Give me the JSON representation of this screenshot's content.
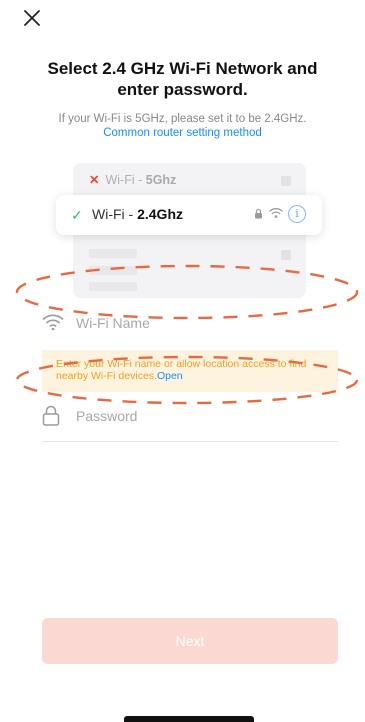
{
  "header": {
    "close_icon": "close-icon",
    "title": "Select 2.4 GHz Wi-Fi Network and enter password.",
    "subtitle": "If your Wi-Fi is 5GHz, please set it to be 2.4GHz.",
    "router_link": "Common router setting method"
  },
  "illustration": {
    "row_5g_prefix": "Wi-Fi - ",
    "row_5g_band": "5Ghz",
    "row_24_prefix": "Wi-Fi - ",
    "row_24_band": "2.4Ghz",
    "info_glyph": "i"
  },
  "form": {
    "wifi_name_placeholder": "Wi-Fi Name",
    "warning_text": "Enter your Wi-Fi name or allow location access to find nearby Wi-Fi devices.",
    "warning_link": "Open",
    "password_placeholder": "Password"
  },
  "footer": {
    "next_label": "Next"
  },
  "colors": {
    "accent_red": "#e24a3b",
    "link_blue": "#1a8cff",
    "warning_text": "#f0a020",
    "warning_bg": "#fdf3df",
    "next_disabled": "#fbd9d2",
    "check_green": "#2fbf71"
  }
}
